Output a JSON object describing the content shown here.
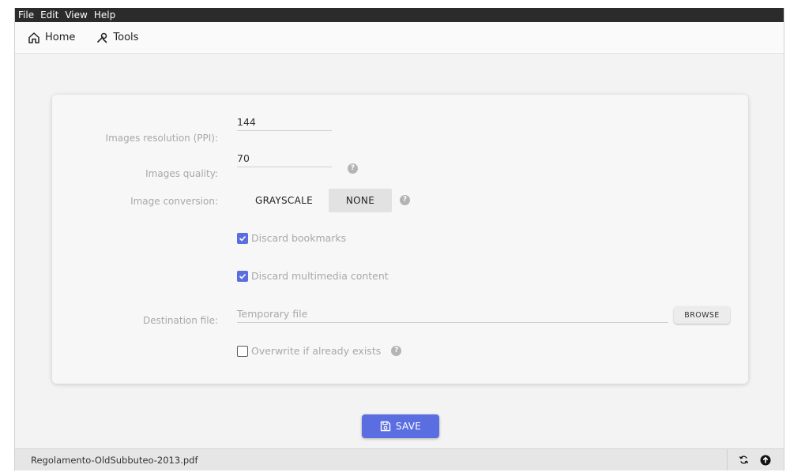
{
  "menu": [
    "File",
    "Edit",
    "View",
    "Help"
  ],
  "toolbar": {
    "home_label": "Home",
    "tools_label": "Tools"
  },
  "form": {
    "resolution_label": "Images resolution (PPI):",
    "resolution_value": "144",
    "quality_label": "Images quality:",
    "quality_value": "70",
    "conversion_label": "Image conversion:",
    "conversion_options": [
      "GRAYSCALE",
      "NONE"
    ],
    "conversion_selected": "NONE",
    "discard_bookmarks_label": "Discard bookmarks",
    "discard_bookmarks_checked": true,
    "discard_multimedia_label": "Discard multimedia content",
    "discard_multimedia_checked": true,
    "destination_label": "Destination file:",
    "destination_placeholder": "Temporary file",
    "browse_label": "BROWSE",
    "overwrite_label": "Overwrite if already exists",
    "overwrite_checked": false,
    "help_glyph": "?"
  },
  "save_label": "SAVE",
  "status": {
    "filename": "Regolamento-OldSubbuteo-2013.pdf"
  },
  "colors": {
    "accent": "#5b6ee1",
    "menubar": "#2b2b2b"
  },
  "icons": [
    "home-icon",
    "tools-icon",
    "help-icon",
    "save-icon",
    "refresh-icon",
    "upload-icon"
  ]
}
